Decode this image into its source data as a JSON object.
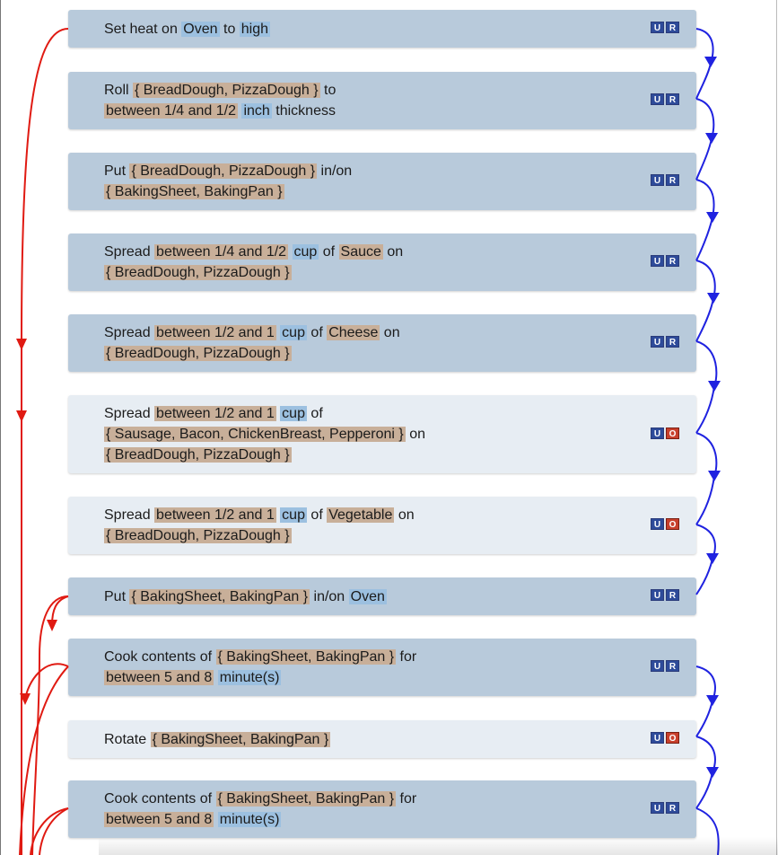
{
  "steps": [
    {
      "kind": "required",
      "lines": [
        [
          {
            "t": "Set heat on "
          },
          {
            "t": "Oven",
            "c": "unit"
          },
          {
            "t": " to "
          },
          {
            "t": "high",
            "c": "unit"
          }
        ]
      ],
      "badges": [
        "U",
        "R"
      ]
    },
    {
      "kind": "required",
      "lines": [
        [
          {
            "t": "Roll "
          },
          {
            "t": "{ BreadDough, PizzaDough }",
            "c": "ing"
          },
          {
            "t": " to"
          }
        ],
        [
          {
            "t": "between 1/4 and 1/2",
            "c": "ing"
          },
          {
            "t": " "
          },
          {
            "t": "inch",
            "c": "unit"
          },
          {
            "t": " thickness"
          }
        ]
      ],
      "badges": [
        "U",
        "R"
      ]
    },
    {
      "kind": "required",
      "lines": [
        [
          {
            "t": "Put "
          },
          {
            "t": "{ BreadDough, PizzaDough }",
            "c": "ing"
          },
          {
            "t": " in/on"
          }
        ],
        [
          {
            "t": "{ BakingSheet, BakingPan }",
            "c": "ing"
          }
        ]
      ],
      "badges": [
        "U",
        "R"
      ]
    },
    {
      "kind": "required",
      "lines": [
        [
          {
            "t": "Spread "
          },
          {
            "t": "between 1/4 and 1/2",
            "c": "ing"
          },
          {
            "t": " "
          },
          {
            "t": "cup",
            "c": "unit"
          },
          {
            "t": " of "
          },
          {
            "t": "Sauce",
            "c": "ing"
          },
          {
            "t": " on"
          }
        ],
        [
          {
            "t": "{ BreadDough, PizzaDough }",
            "c": "ing"
          }
        ]
      ],
      "badges": [
        "U",
        "R"
      ]
    },
    {
      "kind": "required",
      "lines": [
        [
          {
            "t": "Spread "
          },
          {
            "t": "between 1/2 and 1",
            "c": "ing"
          },
          {
            "t": " "
          },
          {
            "t": "cup",
            "c": "unit"
          },
          {
            "t": " of "
          },
          {
            "t": "Cheese",
            "c": "ing"
          },
          {
            "t": " on"
          }
        ],
        [
          {
            "t": "{ BreadDough, PizzaDough }",
            "c": "ing"
          }
        ]
      ],
      "badges": [
        "U",
        "R"
      ]
    },
    {
      "kind": "optional",
      "lines": [
        [
          {
            "t": "Spread "
          },
          {
            "t": "between 1/2 and 1",
            "c": "ing"
          },
          {
            "t": " "
          },
          {
            "t": "cup",
            "c": "unit"
          },
          {
            "t": " of"
          }
        ],
        [
          {
            "t": "{ Sausage, Bacon, ChickenBreast, Pepperoni }",
            "c": "ing"
          },
          {
            "t": " on"
          }
        ],
        [
          {
            "t": "{ BreadDough, PizzaDough }",
            "c": "ing"
          }
        ]
      ],
      "badges": [
        "U",
        "O"
      ]
    },
    {
      "kind": "optional",
      "lines": [
        [
          {
            "t": "Spread "
          },
          {
            "t": "between 1/2 and 1",
            "c": "ing"
          },
          {
            "t": " "
          },
          {
            "t": "cup",
            "c": "unit"
          },
          {
            "t": " of "
          },
          {
            "t": "Vegetable",
            "c": "ing"
          },
          {
            "t": " on"
          }
        ],
        [
          {
            "t": "{ BreadDough, PizzaDough }",
            "c": "ing"
          }
        ]
      ],
      "badges": [
        "U",
        "O"
      ]
    },
    {
      "kind": "required",
      "lines": [
        [
          {
            "t": "Put "
          },
          {
            "t": "{ BakingSheet, BakingPan }",
            "c": "ing"
          },
          {
            "t": " in/on "
          },
          {
            "t": "Oven",
            "c": "unit"
          }
        ]
      ],
      "badges": [
        "U",
        "R"
      ]
    },
    {
      "kind": "required",
      "lines": [
        [
          {
            "t": "Cook contents of "
          },
          {
            "t": "{ BakingSheet, BakingPan }",
            "c": "ing"
          },
          {
            "t": " for"
          }
        ],
        [
          {
            "t": "between 5 and 8",
            "c": "ing"
          },
          {
            "t": " "
          },
          {
            "t": "minute(s)",
            "c": "unit"
          }
        ]
      ],
      "badges": [
        "U",
        "R"
      ]
    },
    {
      "kind": "optional",
      "lines": [
        [
          {
            "t": "Rotate "
          },
          {
            "t": "{ BakingSheet, BakingPan }",
            "c": "ing"
          }
        ]
      ],
      "badges": [
        "U",
        "O"
      ]
    },
    {
      "kind": "required",
      "lines": [
        [
          {
            "t": "Cook contents of "
          },
          {
            "t": "{ BakingSheet, BakingPan }",
            "c": "ing"
          },
          {
            "t": " for"
          }
        ],
        [
          {
            "t": "between 5 and 8",
            "c": "ing"
          },
          {
            "t": " "
          },
          {
            "t": "minute(s)",
            "c": "unit"
          }
        ]
      ],
      "badges": [
        "U",
        "R"
      ]
    }
  ],
  "colors": {
    "required_bg": "#b8cadb",
    "optional_bg": "#e7edf3",
    "ingredient_highlight": "#c8af99",
    "unit_highlight": "#9cc0e0",
    "sequence_arrow": "#1f22e0",
    "dependency_arrow": "#e01a12",
    "badge_blue": "#2e4b9a",
    "badge_red": "#c8402c"
  },
  "icons": {
    "sequence_arrows": "down-arrow-icon",
    "dependency_arrows": "curved-arrow-icon"
  }
}
